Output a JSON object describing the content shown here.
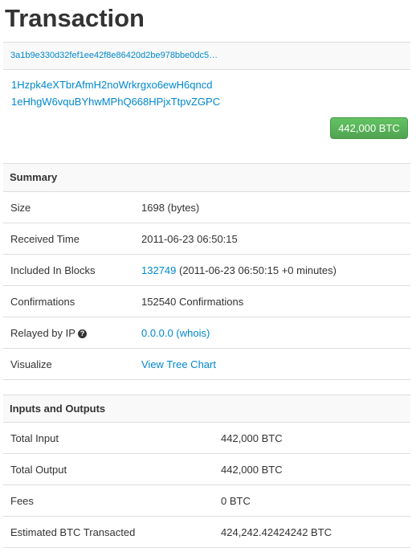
{
  "page": {
    "title": "Transaction"
  },
  "tx": {
    "hash": "3a1b9e330d32fef1ee42f8e86420d2be978bbe0dc5…",
    "addresses": [
      "1Hzpk4eXTbrAfmH2noWrkrgxo6ewH6qncd",
      "1eHhgW6vquBYhwMPhQ668HPjxTtpvZGPC"
    ],
    "amount": "442,000 BTC"
  },
  "summary": {
    "heading": "Summary",
    "size_label": "Size",
    "size_value": "1698 (bytes)",
    "received_label": "Received Time",
    "received_value": "2011-06-23 06:50:15",
    "blocks_label": "Included In Blocks",
    "block_number": "132749",
    "block_detail": " (2011-06-23 06:50:15 +0 minutes)",
    "confirmations_label": "Confirmations",
    "confirmations_value": "152540 Confirmations",
    "relayed_label": "Relayed by IP",
    "relayed_icon": "question-circle-icon",
    "relayed_icon_glyph": "?",
    "relayed_ip": "0.0.0.0",
    "relayed_whois": "(whois)",
    "visualize_label": "Visualize",
    "visualize_link": "View Tree Chart"
  },
  "io": {
    "heading": "Inputs and Outputs",
    "total_input_label": "Total Input",
    "total_input_value": "442,000 BTC",
    "total_output_label": "Total Output",
    "total_output_value": "442,000 BTC",
    "fees_label": "Fees",
    "fees_value": "0 BTC",
    "estimated_label": "Estimated BTC Transacted",
    "estimated_value": "424,242.42424242 BTC"
  },
  "colors": {
    "link": "#0088cc",
    "success": "#5bb75b",
    "text": "#333333",
    "border": "#dddddd"
  }
}
